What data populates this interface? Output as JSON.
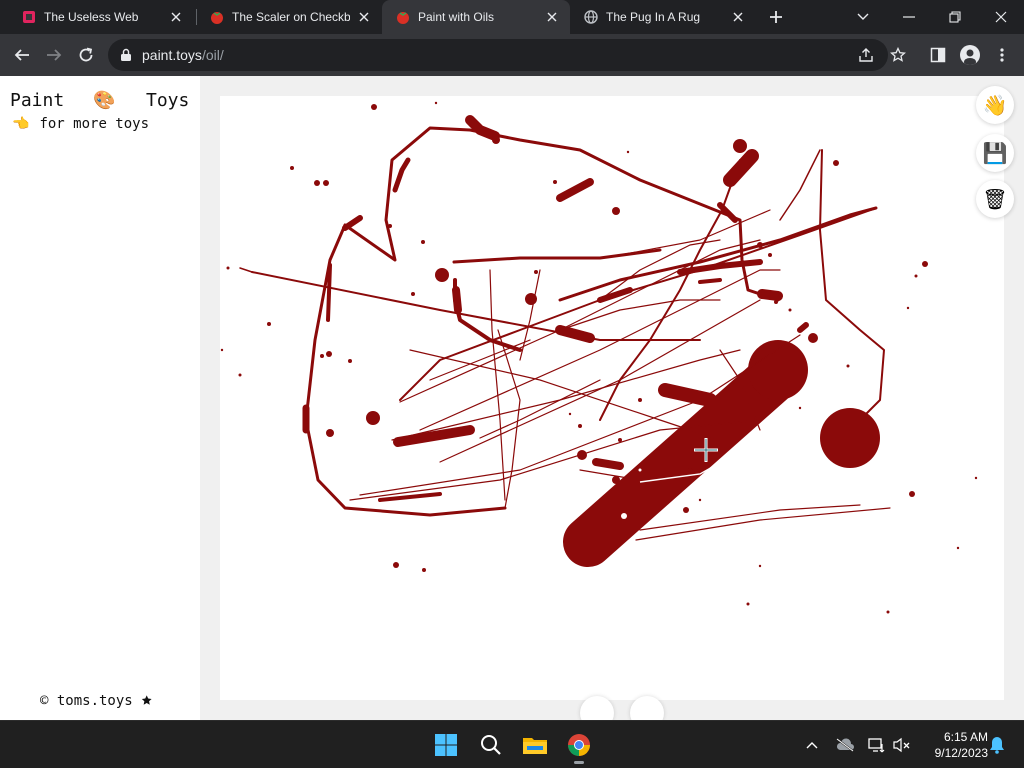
{
  "browser": {
    "tabs": [
      {
        "title": "The Useless Web",
        "favicon": "useless-web-icon",
        "favicon_color": "#e0245e",
        "active": false
      },
      {
        "title": "The Scaler on Checkbox",
        "favicon": "tomato-icon",
        "favicon_color": "#d93025",
        "active": false
      },
      {
        "title": "Paint with Oils",
        "favicon": "tomato-icon",
        "favicon_color": "#d93025",
        "active": true
      },
      {
        "title": "The Pug In A Rug",
        "favicon": "globe-icon",
        "favicon_color": "#9aa0a6",
        "active": false
      }
    ],
    "url_host": "paint.toys",
    "url_path": "/oil/"
  },
  "sidebar": {
    "brand_left": "Paint",
    "brand_icon": "🎨",
    "brand_right": "Toys",
    "more_icon": "👈",
    "more_link": "for more toys",
    "copyright": "© toms.toys 🟊"
  },
  "tools": [
    {
      "name": "wave-tool",
      "glyph": "👋"
    },
    {
      "name": "save-tool",
      "glyph": "💾"
    },
    {
      "name": "trash-tool",
      "glyph": "🗑"
    }
  ],
  "paint": {
    "color": "#8b0a0a"
  },
  "taskbar": {
    "time": "6:15 AM",
    "date": "9/12/2023"
  }
}
